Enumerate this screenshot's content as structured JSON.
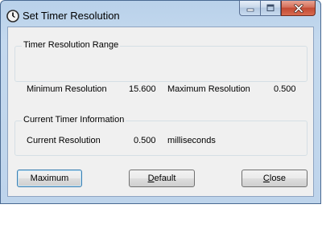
{
  "window": {
    "title": "Set Timer Resolution",
    "icon": "clock-icon"
  },
  "caption_buttons": {
    "minimize_icon": "minimize-icon",
    "maximize_icon": "maximize-icon",
    "close_icon": "close-icon"
  },
  "range_group": {
    "legend": "Timer Resolution Range",
    "min_label": "Minimum Resolution",
    "min_value": "15.600",
    "max_label": "Maximum Resolution",
    "max_value": "0.500"
  },
  "current_group": {
    "legend": "Current Timer Information",
    "current_label": "Current Resolution",
    "current_value": "0.500",
    "unit": "milliseconds"
  },
  "buttons": {
    "maximum": "Maximum",
    "default_first": "D",
    "default_rest": "efault",
    "close_first": "C",
    "close_rest": "lose"
  },
  "colors": {
    "frame": "#bed4eb",
    "client": "#f0f0f0",
    "close_button": "#c24a33"
  }
}
